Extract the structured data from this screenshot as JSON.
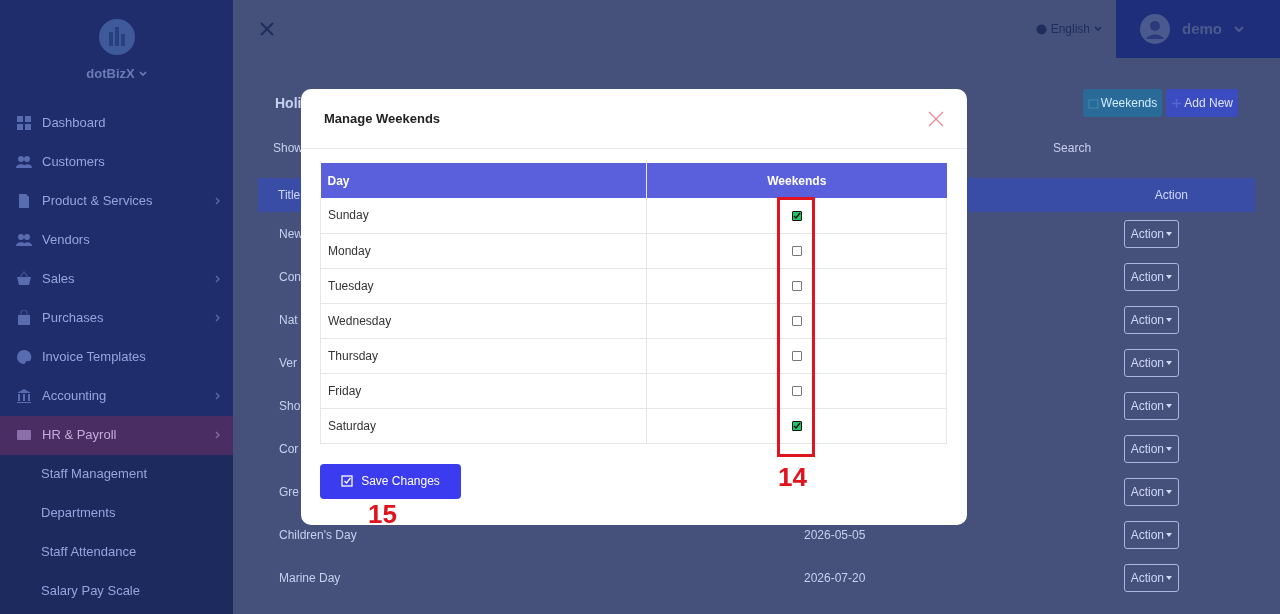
{
  "sidebar": {
    "brand": "dotBizX",
    "items": [
      {
        "label": "Dashboard",
        "has_submenu": false,
        "selected": false
      },
      {
        "label": "Customers",
        "has_submenu": false,
        "selected": false
      },
      {
        "label": "Product & Services",
        "has_submenu": true,
        "selected": false
      },
      {
        "label": "Vendors",
        "has_submenu": false,
        "selected": false
      },
      {
        "label": "Sales",
        "has_submenu": true,
        "selected": false
      },
      {
        "label": "Purchases",
        "has_submenu": true,
        "selected": false
      },
      {
        "label": "Invoice Templates",
        "has_submenu": false,
        "selected": false
      },
      {
        "label": "Accounting",
        "has_submenu": true,
        "selected": false
      },
      {
        "label": "HR & Payroll",
        "has_submenu": true,
        "selected": true
      }
    ],
    "subitems": [
      "Staff Management",
      "Departments",
      "Staff Attendance",
      "Salary Pay Scale"
    ]
  },
  "header": {
    "language": "English",
    "user": "demo"
  },
  "page": {
    "title": "Holi",
    "show_label": "Show",
    "search_label": "Search",
    "buttons": [
      "Weekends",
      "Add New"
    ],
    "columns": [
      "Title",
      "Action"
    ],
    "rows": [
      {
        "title": "New",
        "action": "Action"
      },
      {
        "title": "Con",
        "action": "Action"
      },
      {
        "title": "Nat",
        "action": "Action"
      },
      {
        "title": "Ver",
        "action": "Action"
      },
      {
        "title": "Sho",
        "action": "Action"
      },
      {
        "title": "Cor",
        "action": "Action"
      },
      {
        "title": "Gre",
        "action": "Action"
      },
      {
        "title": "Children's Day",
        "date": "2026-05-05",
        "action": "Action"
      },
      {
        "title": "Marine Day",
        "date": "2026-07-20",
        "action": "Action"
      }
    ]
  },
  "modal": {
    "title": "Manage Weekends",
    "columns": [
      "Day",
      "Weekends"
    ],
    "days": [
      {
        "name": "Sunday",
        "checked": true
      },
      {
        "name": "Monday",
        "checked": false
      },
      {
        "name": "Tuesday",
        "checked": false
      },
      {
        "name": "Wednesday",
        "checked": false
      },
      {
        "name": "Thursday",
        "checked": false
      },
      {
        "name": "Friday",
        "checked": false
      },
      {
        "name": "Saturday",
        "checked": true
      }
    ],
    "save_button": "Save Changes"
  },
  "annotations": [
    "14",
    "15"
  ]
}
